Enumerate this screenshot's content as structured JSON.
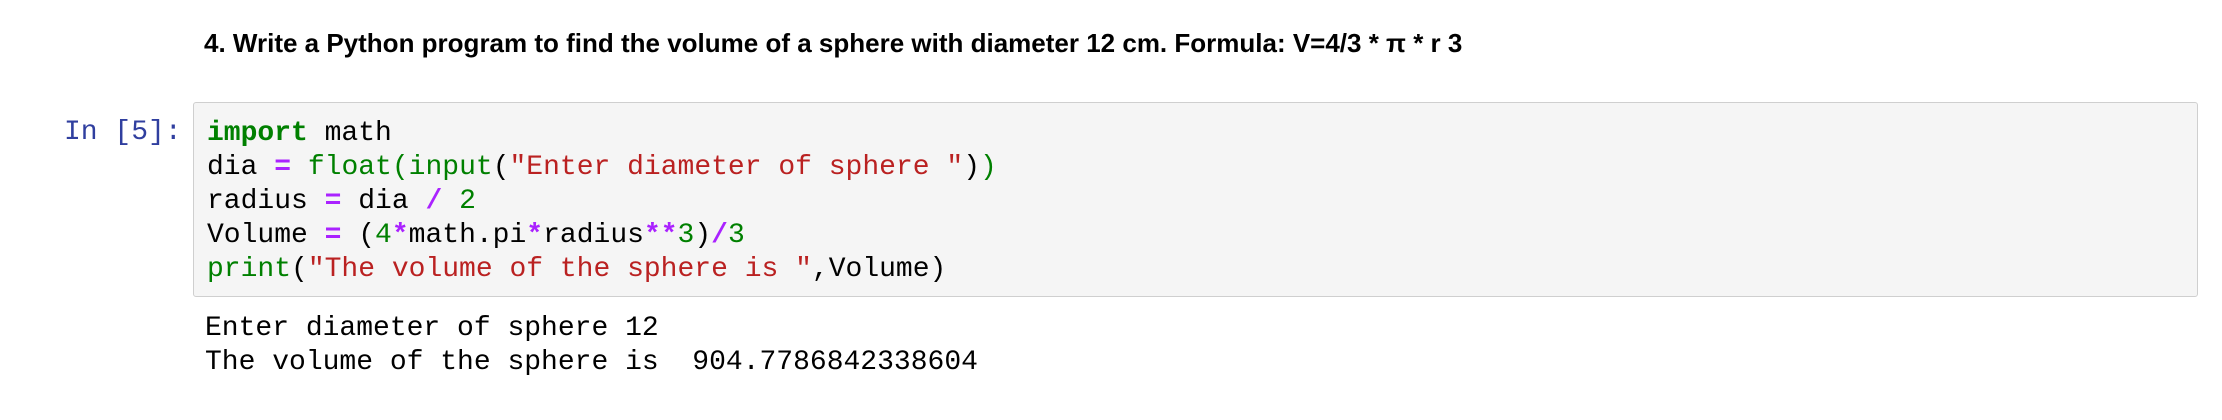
{
  "markdown": {
    "heading": "4. Write a Python program to find the volume of a sphere with diameter 12 cm. Formula: V=4/3 * π * r 3"
  },
  "cell": {
    "prompt": "In [5]:",
    "code": {
      "line1": {
        "kw": "import",
        "rest": " math"
      },
      "line2": {
        "var": "dia ",
        "eq": "=",
        "sp": " ",
        "fn1": "float",
        "p1": "(",
        "fn2": "input",
        "p2": "(",
        "str": "\"Enter diameter of sphere \"",
        "p3": ")",
        "p4": ")"
      },
      "line3": {
        "var": "radius ",
        "eq": "=",
        "mid": " dia ",
        "div": "/",
        "sp": " ",
        "num": "2"
      },
      "line4": {
        "var": "Volume ",
        "eq": "=",
        "p1": " (",
        "n4": "4",
        "m1": "*",
        "mid": "math.pi",
        "m2": "*",
        "rad": "radius",
        "pow": "**",
        "n3": "3",
        "p2": ")",
        "div": "/",
        "n3b": "3"
      },
      "line5": {
        "fn": "print",
        "p1": "(",
        "str": "\"The volume of the sphere is \"",
        "rest": ",Volume)"
      }
    },
    "output": [
      "Enter diameter of sphere 12",
      "The volume of the sphere is  904.7786842338604"
    ]
  }
}
